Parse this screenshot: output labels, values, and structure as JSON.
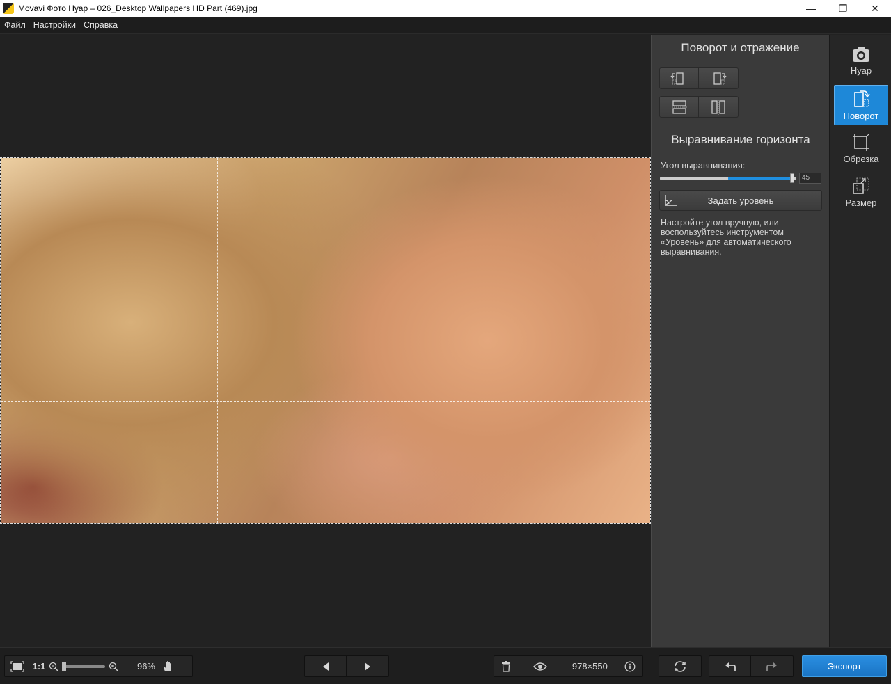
{
  "window": {
    "title": "Movavi Фото Нуар – 026_Desktop Wallpapers  HD Part (469).jpg",
    "minimize": "—",
    "maximize": "❐",
    "close": "✕"
  },
  "menu": [
    "Файл",
    "Настройки",
    "Справка"
  ],
  "panel": {
    "heading": "Поворот и отражение",
    "horizon_heading": "Выравнивание горизонта",
    "angle_label": "Угол выравнивания:",
    "angle_value": "45",
    "angle_fraction": 0.97,
    "level_button": "Задать уровень",
    "hint": "Настройте угол вручную, или воспользуйтесь инструментом «Уровень» для автоматического выравнивания."
  },
  "tools": [
    {
      "label": "Нуар",
      "icon": "camera-icon",
      "active": false
    },
    {
      "label": "Поворот",
      "icon": "rotate-icon",
      "active": true
    },
    {
      "label": "Обрезка",
      "icon": "crop-icon",
      "active": false
    },
    {
      "label": "Размер",
      "icon": "resize-icon",
      "active": false
    }
  ],
  "bottom": {
    "one_to_one": "1:1",
    "zoom": "96%",
    "dimensions": "978×550",
    "export": "Экспорт"
  },
  "colors": {
    "accent": "#1e88d8",
    "panel": "#3a3a3a",
    "background": "#222222"
  }
}
